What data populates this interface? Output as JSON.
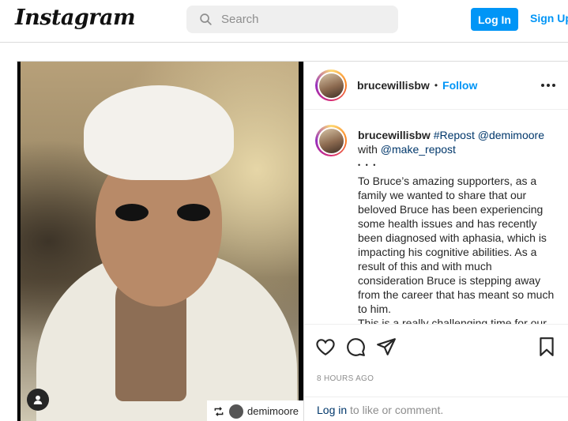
{
  "nav": {
    "logo": "Instagram",
    "search_placeholder": "Search",
    "login_label": "Log In",
    "signup_label": "Sign Up"
  },
  "post": {
    "username": "brucewillisbw",
    "separator": "•",
    "follow_label": "Follow",
    "repost_tag_username": "demimoore",
    "caption": {
      "username": "brucewillisbw",
      "repost_hashtag": "#Repost",
      "mention_1": "@demimoore",
      "with_word": "with",
      "mention_2": "@make_repost",
      "dots": "• • •",
      "lines": [
        "To Bruce’s amazing supporters, as a",
        "family we wanted to share that our",
        "beloved Bruce has been experiencing",
        "some health issues and has recently",
        "been diagnosed with aphasia, which is",
        "impacting his cognitive abilities. As a",
        "result of this and with much",
        "consideration Bruce is stepping away",
        "from the career that has meant so much",
        "to him.",
        "This is a really challenging time for our"
      ]
    },
    "timestamp": "8 HOURS AGO",
    "login_prompt_link": "Log in",
    "login_prompt_rest": " to like or comment."
  },
  "icons": {
    "search": "search-icon",
    "more": "more-options-icon",
    "like": "heart-icon",
    "comment": "comment-icon",
    "share": "send-icon",
    "save": "bookmark-icon",
    "user_tag": "user-tag-icon",
    "repost": "repost-icon"
  },
  "colors": {
    "brand_blue": "#0095f6",
    "link_dark_blue": "#00376b",
    "muted": "#8e8e8e"
  }
}
